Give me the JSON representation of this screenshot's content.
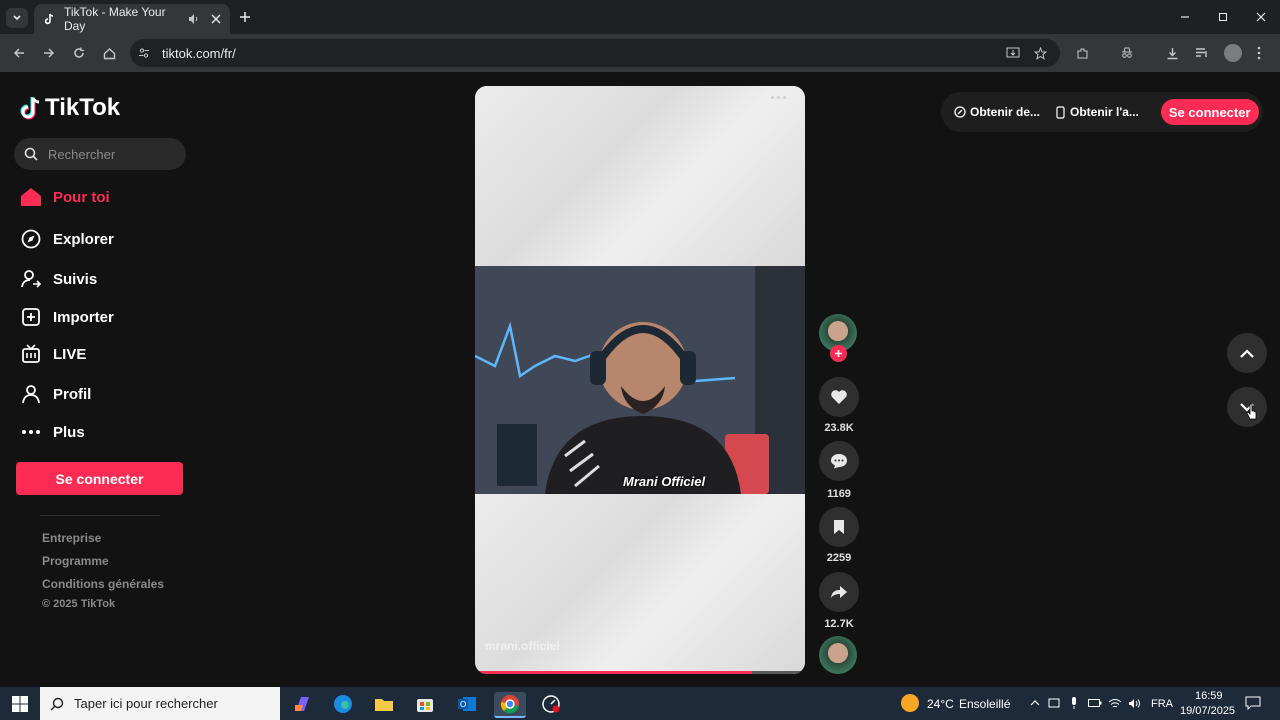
{
  "browser": {
    "tab_title": "TikTok - Make Your Day",
    "url": "tiktok.com/fr/"
  },
  "sidebar": {
    "logo_text": "TikTok",
    "search_placeholder": "Rechercher",
    "nav": [
      {
        "label": "Pour toi",
        "icon": "home-icon",
        "active": true
      },
      {
        "label": "Explorer",
        "icon": "compass-icon"
      },
      {
        "label": "Suivis",
        "icon": "following-icon"
      },
      {
        "label": "Importer",
        "icon": "upload-icon"
      },
      {
        "label": "LIVE",
        "icon": "live-icon"
      },
      {
        "label": "Profil",
        "icon": "profile-icon"
      },
      {
        "label": "Plus",
        "icon": "more-icon"
      }
    ],
    "login_label": "Se connecter",
    "footer": [
      "Entreprise",
      "Programme",
      "Conditions générales"
    ],
    "copyright": "© 2025 TikTok"
  },
  "video": {
    "username_watermark": "mrani.officiel",
    "overlay_text": "Mrani Officiel",
    "progress": 0.84,
    "likes": "23.8K",
    "comments": "1169",
    "saves": "2259",
    "shares": "12.7K"
  },
  "topbar": {
    "get_coins": "Obtenir de...",
    "get_app": "Obtenir l'a...",
    "login": "Se connecter"
  },
  "taskbar": {
    "search_placeholder": "Taper ici pour rechercher",
    "weather": "24°C",
    "weather_desc": "Ensoleillé",
    "lang": "FRA",
    "time": "16:59",
    "date": "19/07/2025"
  },
  "colors": {
    "accent": "#fe2c55",
    "background": "#121212"
  }
}
